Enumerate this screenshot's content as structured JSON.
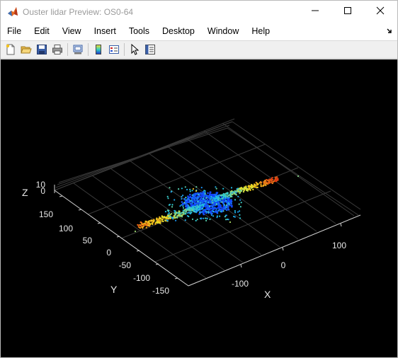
{
  "window": {
    "title": "Ouster lidar Preview: OS0-64",
    "icon": "matlab-icon",
    "controls": [
      "minimize-icon",
      "maximize-icon",
      "close-icon"
    ]
  },
  "menu": {
    "items": [
      "File",
      "Edit",
      "View",
      "Insert",
      "Tools",
      "Desktop",
      "Window",
      "Help"
    ]
  },
  "toolbar": {
    "buttons": [
      "new-figure-icon",
      "open-file-icon",
      "save-icon",
      "print-icon",
      "link-plot-icon",
      "colorbar-icon",
      "legend-icon",
      "pointer-icon",
      "property-editor-icon"
    ]
  },
  "axes": {
    "z_label": "Z",
    "y_label": "Y",
    "x_label": "X",
    "z_ticks": [
      "10",
      "0"
    ],
    "y_ticks": [
      "150",
      "100",
      "50",
      "0",
      "-50",
      "-100",
      "-150"
    ],
    "x_ticks": [
      "-100",
      "0",
      "100"
    ]
  },
  "colors": {
    "background": "#000000",
    "grid": "#3c3c3c",
    "axis": "#d0d0d0",
    "points_low": "#1030ff",
    "points_mid": "#20c8e0",
    "points_high": "#f0e020",
    "points_top": "#e03010"
  }
}
